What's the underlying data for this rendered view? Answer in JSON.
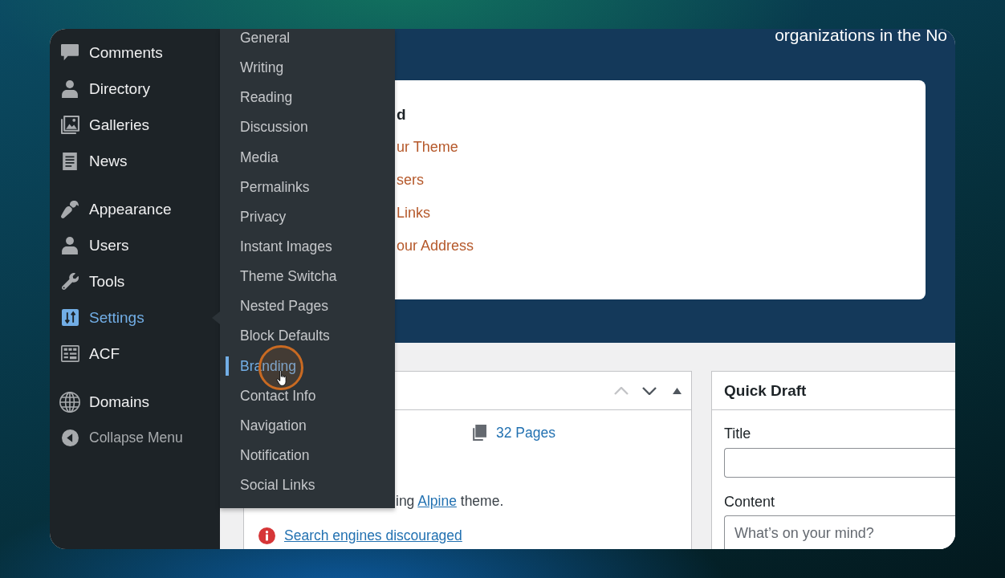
{
  "sidebar": {
    "groups": [
      {
        "items": [
          {
            "label": "Comments",
            "selected": false
          },
          {
            "label": "Directory",
            "selected": false
          },
          {
            "label": "Galleries",
            "selected": false
          },
          {
            "label": "News",
            "selected": false
          }
        ]
      },
      {
        "items": [
          {
            "label": "Appearance",
            "selected": false
          },
          {
            "label": "Users",
            "selected": false
          },
          {
            "label": "Tools",
            "selected": false
          },
          {
            "label": "Settings",
            "selected": true
          },
          {
            "label": "ACF",
            "selected": false
          }
        ]
      },
      {
        "items": [
          {
            "label": "Domains",
            "selected": false
          }
        ]
      }
    ],
    "collapse_label": "Collapse Menu"
  },
  "settings_submenu": {
    "items": [
      {
        "label": "General",
        "selected": false
      },
      {
        "label": "Writing",
        "selected": false
      },
      {
        "label": "Reading",
        "selected": false
      },
      {
        "label": "Discussion",
        "selected": false
      },
      {
        "label": "Media",
        "selected": false
      },
      {
        "label": "Permalinks",
        "selected": false
      },
      {
        "label": "Privacy",
        "selected": false
      },
      {
        "label": "Instant Images",
        "selected": false
      },
      {
        "label": "Theme Switcha",
        "selected": false
      },
      {
        "label": "Nested Pages",
        "selected": false
      },
      {
        "label": "Block Defaults",
        "selected": false
      },
      {
        "label": "Branding",
        "selected": true
      },
      {
        "label": "Contact Info",
        "selected": false
      },
      {
        "label": "Navigation",
        "selected": false
      },
      {
        "label": "Notification",
        "selected": false
      },
      {
        "label": "Social Links",
        "selected": false
      }
    ]
  },
  "header": {
    "text": "organizations in the No"
  },
  "welcome_card": {
    "heading": "d",
    "links": [
      "ur Theme",
      "sers",
      "Links",
      "our Address"
    ]
  },
  "glance_panel": {
    "controls": [
      {
        "kind": "up",
        "disabled": true
      },
      {
        "kind": "down",
        "disabled": false
      },
      {
        "kind": "toggle",
        "disabled": false
      }
    ],
    "pages_link": "32 Pages",
    "theme_notice": {
      "before": "ing ",
      "link": "Alpine",
      "after": " theme."
    },
    "warning_link": "Search engines discouraged"
  },
  "quick_draft": {
    "title": "Quick Draft",
    "title_field": {
      "label": "Title"
    },
    "content_field": {
      "label": "Content",
      "placeholder": "What’s on your mind?"
    }
  }
}
